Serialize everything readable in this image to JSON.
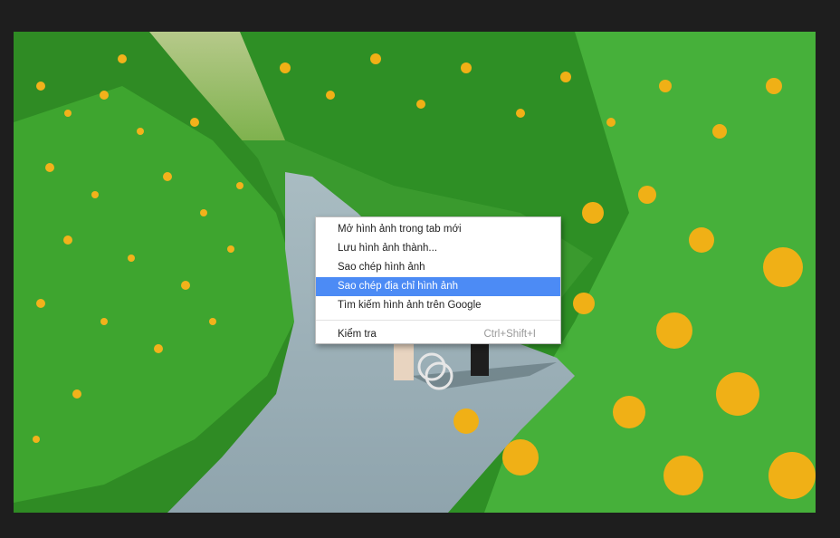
{
  "photo": {
    "subject": "scenic-photo"
  },
  "context_menu": {
    "items": [
      {
        "label": "Mở hình ảnh trong tab mới",
        "shortcut": ""
      },
      {
        "label": "Lưu hình ảnh thành...",
        "shortcut": ""
      },
      {
        "label": "Sao chép hình ảnh",
        "shortcut": ""
      },
      {
        "label": "Sao chép địa chỉ hình ảnh",
        "shortcut": "",
        "selected": true
      },
      {
        "label": "Tìm kiếm hình ảnh trên Google",
        "shortcut": ""
      },
      {
        "label": "Kiểm tra",
        "shortcut": "Ctrl+Shift+I"
      }
    ]
  },
  "colors": {
    "background": "#1e1e1e",
    "menu_highlight": "#4c8bf5"
  }
}
